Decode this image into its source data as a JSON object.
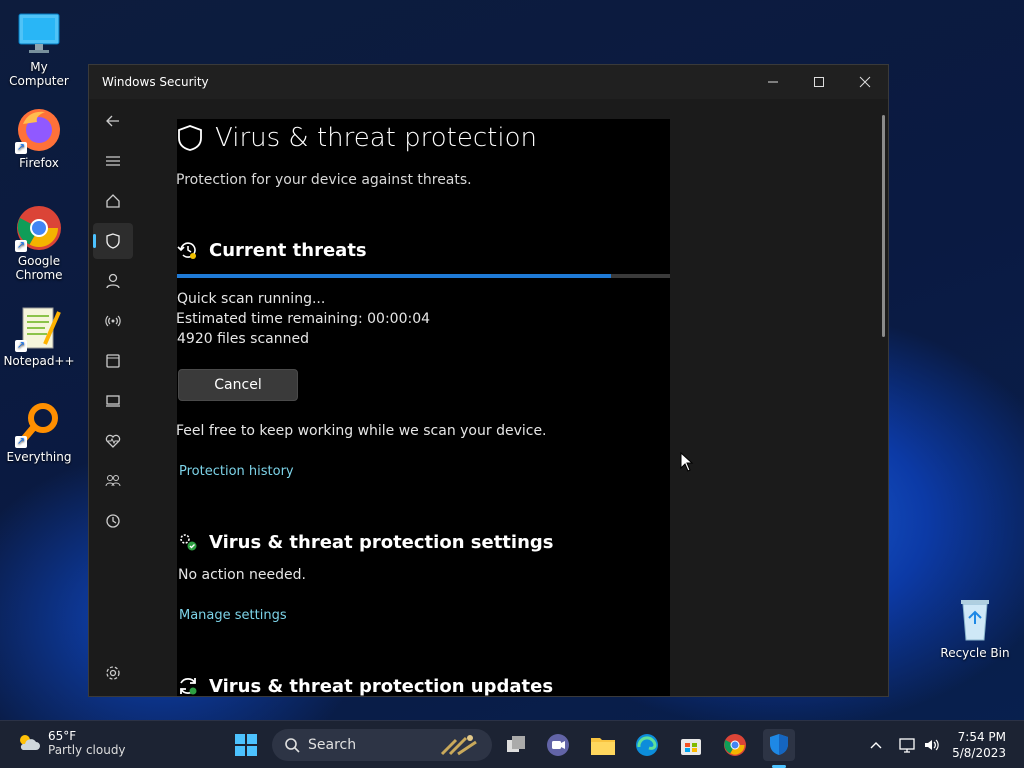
{
  "desktop": {
    "icons": [
      {
        "label": "My Computer"
      },
      {
        "label": "Firefox"
      },
      {
        "label": "Google Chrome"
      },
      {
        "label": "Notepad++"
      },
      {
        "label": "Everything"
      },
      {
        "label": "Recycle Bin"
      }
    ]
  },
  "window": {
    "title": "Windows Security",
    "heading": "Virus & threat protection",
    "subtitle": "Protection for your device against threats.",
    "current_threats": {
      "title": "Current threats",
      "progress": 0.88,
      "status": "Quick scan running...",
      "time_label": "Estimated time remaining:",
      "time_value": "00:00:04",
      "files_count": "4920",
      "files_label": "files scanned",
      "cancel_label": "Cancel",
      "note": "Feel free to keep working while we scan your device.",
      "history_link": "Protection history"
    },
    "settings_section": {
      "title": "Virus & threat protection settings",
      "status": "No action needed.",
      "link": "Manage settings"
    },
    "updates_section": {
      "title": "Virus & threat protection updates"
    },
    "nav": [
      "back-icon",
      "menu-icon",
      "home-icon",
      "shield-icon",
      "account-icon",
      "firewall-icon",
      "app-browser-icon",
      "device-security-icon",
      "device-health-icon",
      "family-icon",
      "history-icon",
      "settings-icon"
    ]
  },
  "taskbar": {
    "weather_temp": "65°F",
    "weather_desc": "Partly cloudy",
    "search_placeholder": "Search",
    "time": "7:54 PM",
    "date": "5/8/2023"
  },
  "colors": {
    "accent": "#4cc2ff",
    "progress": "#1f7ad6",
    "link": "#7dd3e8"
  }
}
